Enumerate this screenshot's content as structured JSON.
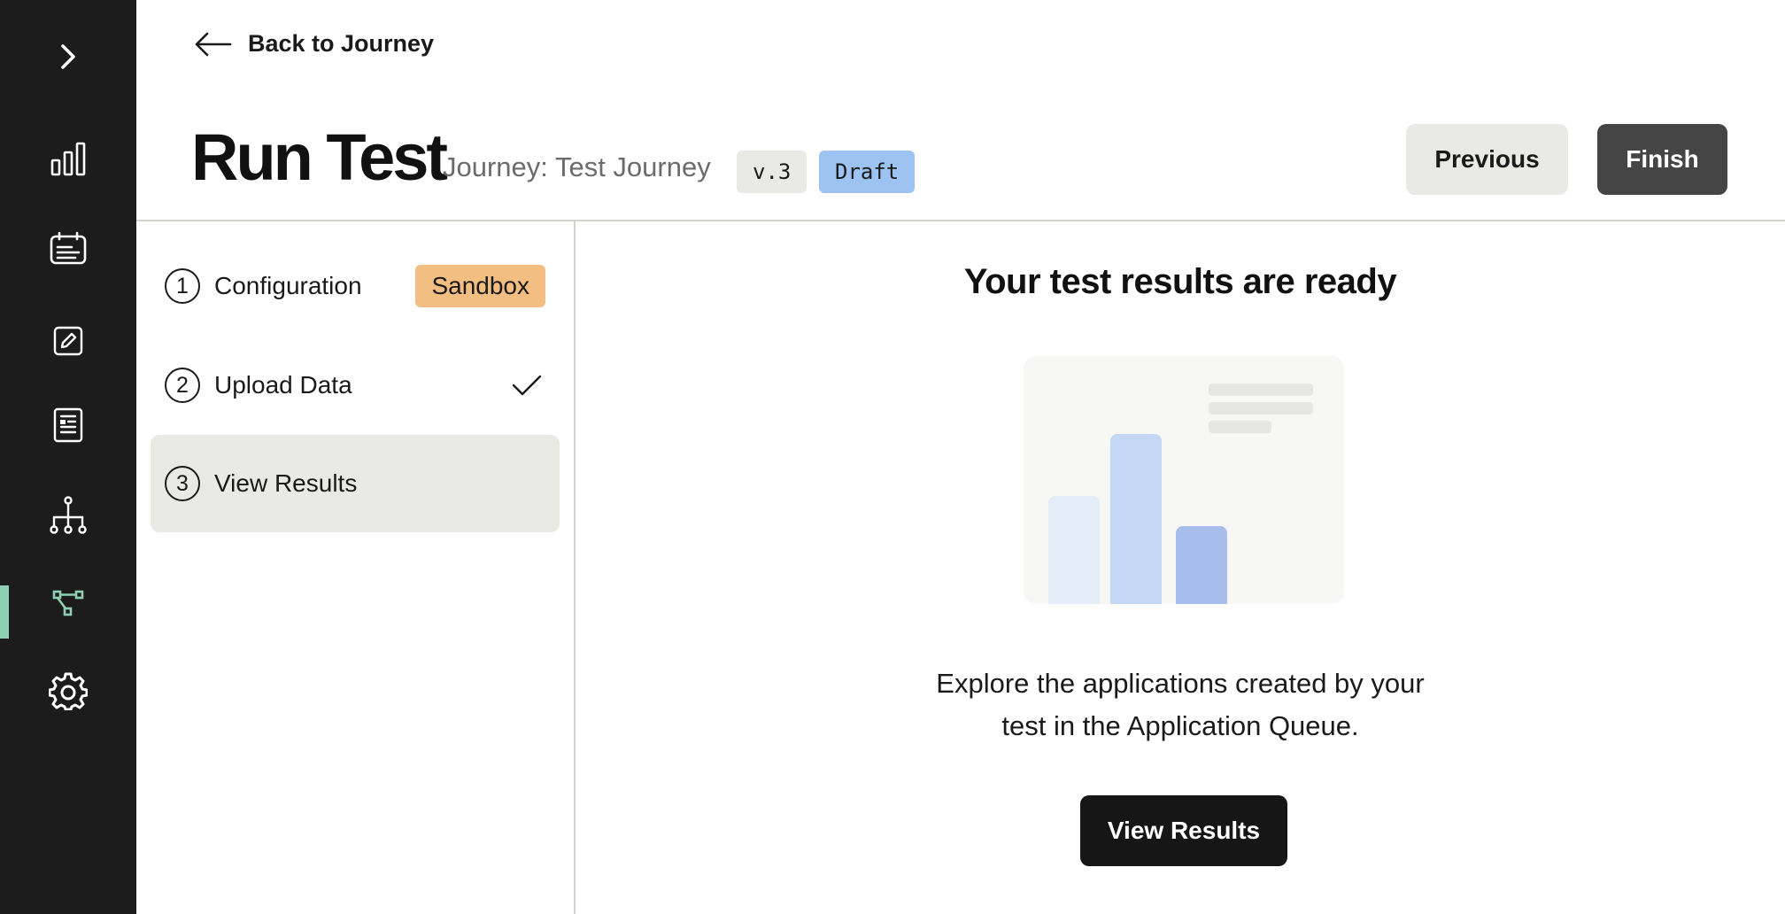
{
  "sidebar": {
    "items": [
      {
        "icon": "chevron-right-icon"
      },
      {
        "icon": "bar-chart-icon"
      },
      {
        "icon": "calendar-list-icon"
      },
      {
        "icon": "edit-icon"
      },
      {
        "icon": "document-icon"
      },
      {
        "icon": "hierarchy-icon"
      },
      {
        "icon": "workflow-icon",
        "active": true
      },
      {
        "icon": "gear-icon"
      }
    ],
    "active_color": "#8fd0b5"
  },
  "header": {
    "back_label": "Back to Journey",
    "title": "Run Test",
    "journey_label": "Journey: Test Journey",
    "version_badge": "v.3",
    "status_badge": "Draft",
    "previous_label": "Previous",
    "finish_label": "Finish"
  },
  "steps": [
    {
      "number": "1",
      "label": "Configuration",
      "badge": "Sandbox"
    },
    {
      "number": "2",
      "label": "Upload Data",
      "completed": true
    },
    {
      "number": "3",
      "label": "View Results",
      "active": true
    }
  ],
  "main": {
    "title": "Your test results are ready",
    "description_line1": "Explore the applications created by your",
    "description_line2": "test in the Application Queue.",
    "view_results_label": "View Results"
  },
  "colors": {
    "sidebar_bg": "#1c1c1c",
    "sandbox_badge": "#f2be82",
    "draft_badge": "#9cc3f2",
    "finish_button": "#454545",
    "view_button": "#161616"
  }
}
